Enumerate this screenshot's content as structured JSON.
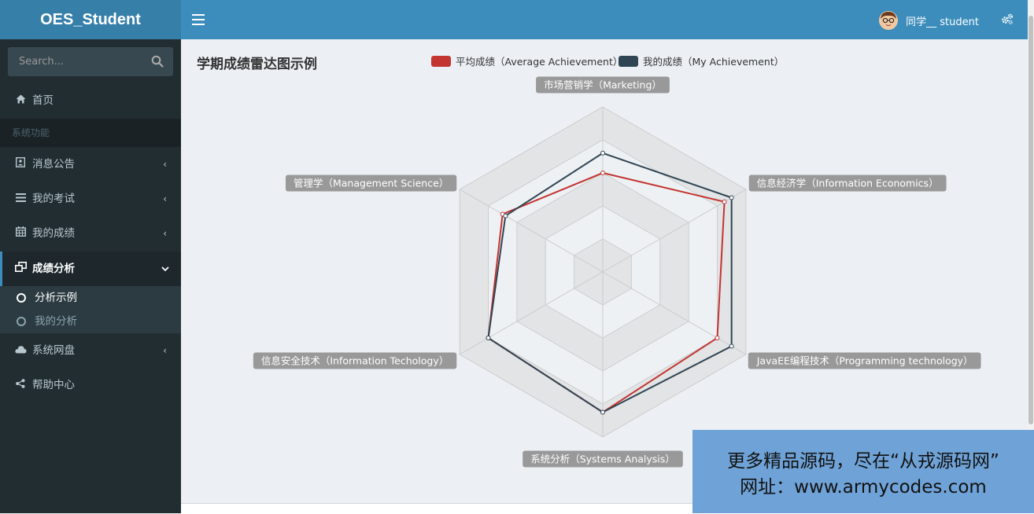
{
  "app": {
    "logo": "OES_Student"
  },
  "header": {
    "user_label": "同学__ student"
  },
  "sidebar": {
    "search_placeholder": "Search...",
    "home": "首页",
    "section_header": "系统功能",
    "items": [
      {
        "label": "消息公告",
        "icon": "id-card-icon"
      },
      {
        "label": "我的考试",
        "icon": "list-icon"
      },
      {
        "label": "我的成绩",
        "icon": "calendar-icon"
      },
      {
        "label": "成绩分析",
        "icon": "window-icon"
      },
      {
        "label": "系统网盘",
        "icon": "cloud-icon"
      },
      {
        "label": "帮助中心",
        "icon": "share-icon"
      }
    ],
    "subitems": [
      {
        "label": "分析示例"
      },
      {
        "label": "我的分析"
      }
    ]
  },
  "chart_data": {
    "type": "radar",
    "title": "学期成绩雷达图示例",
    "indicators": [
      "市场营销学（Marketing）",
      "信息经济学（Information Economics）",
      "JavaEE编程技术（Programming technology）",
      "系统分析（Systems Analysis）",
      "信息安全技术（Information Techology）",
      "管理学（Management Science）"
    ],
    "max": 100,
    "series": [
      {
        "name": "平均成绩（Average Achievement）",
        "color": "#c23531",
        "values": [
          60,
          85,
          80,
          85,
          80,
          70
        ]
      },
      {
        "name": "我的成绩（My Achievement）",
        "color": "#2f4554",
        "values": [
          72,
          90,
          90,
          85,
          80,
          68
        ]
      }
    ],
    "legend_position": "top-center"
  },
  "watermark": {
    "line1": "更多精品源码，尽在“从戎源码网”",
    "line2": "网址：www.armycodes.com"
  },
  "colors": {
    "navbar": "#3c8dbc",
    "logo_bar": "#367fa9",
    "sidebar": "#222d32",
    "content_bg": "#ecf0f5"
  }
}
